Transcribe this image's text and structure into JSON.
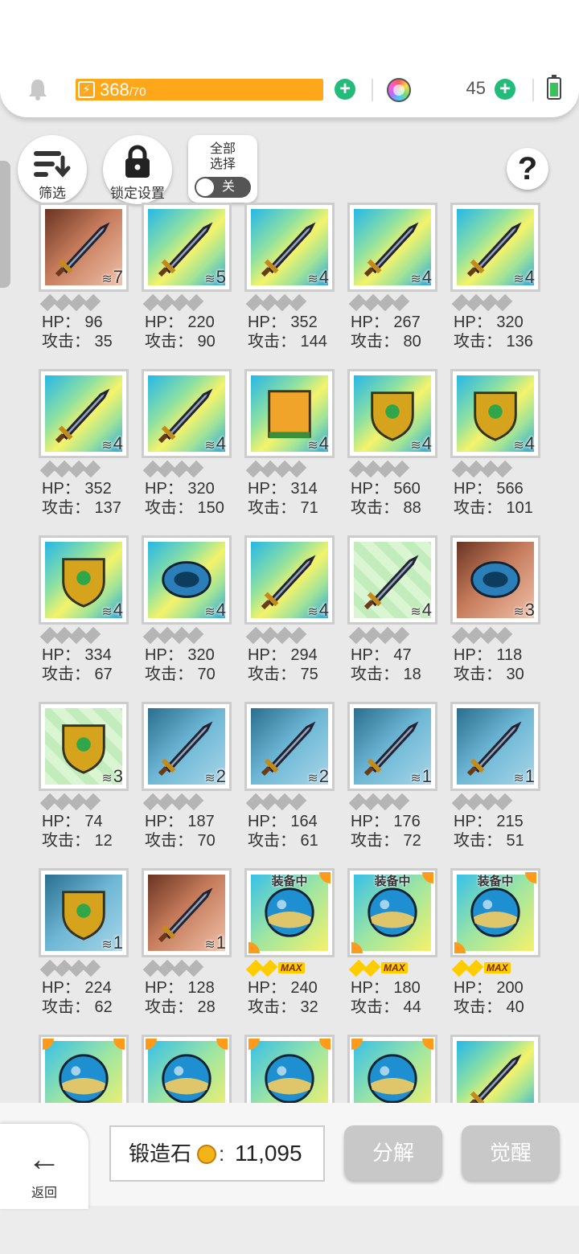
{
  "header": {
    "energy_value": "368",
    "energy_max": "/70",
    "gem_count": "45",
    "colors": {
      "energy": "#ffa71a",
      "plus": "#22bb7a",
      "battery": "#3cc05a"
    }
  },
  "toolbar": {
    "filter_label": "筛选",
    "lock_label": "锁定设置",
    "select_all_label": "全部\n选择",
    "toggle_state": "关",
    "help_label": "?"
  },
  "items": [
    {
      "count": "7",
      "hp": "HP： 96",
      "atk": "攻击： 35",
      "bg": "brown",
      "icon": "sword-icon"
    },
    {
      "count": "5",
      "hp": "HP： 220",
      "atk": "攻击： 90",
      "bg": "rainbow",
      "icon": "golden-spear-icon"
    },
    {
      "count": "4",
      "hp": "HP： 352",
      "atk": "攻击： 144",
      "bg": "rainbow",
      "icon": "blue-sword-icon"
    },
    {
      "count": "4",
      "hp": "HP： 267",
      "atk": "攻击： 80",
      "bg": "rainbow",
      "icon": "crystal-sword-icon"
    },
    {
      "count": "4",
      "hp": "HP： 320",
      "atk": "攻击： 136",
      "bg": "rainbow",
      "icon": "axe-icon"
    },
    {
      "count": "4",
      "hp": "HP： 352",
      "atk": "攻击： 137",
      "bg": "rainbow",
      "icon": "pink-axe-icon"
    },
    {
      "count": "4",
      "hp": "HP： 320",
      "atk": "攻击： 150",
      "bg": "rainbow",
      "icon": "staff-icon"
    },
    {
      "count": "4",
      "hp": "HP： 314",
      "atk": "攻击： 71",
      "bg": "rainbow",
      "icon": "spellbook-icon"
    },
    {
      "count": "4",
      "hp": "HP： 560",
      "atk": "攻击： 88",
      "bg": "rainbow",
      "icon": "winged-shield-icon"
    },
    {
      "count": "4",
      "hp": "HP： 566",
      "atk": "攻击： 101",
      "bg": "rainbow",
      "icon": "dark-shield-icon"
    },
    {
      "count": "4",
      "hp": "HP： 334",
      "atk": "攻击： 67",
      "bg": "rainbow",
      "icon": "emerald-shield-icon"
    },
    {
      "count": "4",
      "hp": "HP： 320",
      "atk": "攻击： 70",
      "bg": "rainbow",
      "icon": "headband-icon"
    },
    {
      "count": "4",
      "hp": "HP： 294",
      "atk": "攻击： 75",
      "bg": "rainbow",
      "icon": "sniper-rifle-icon"
    },
    {
      "count": "4",
      "hp": "HP： 47",
      "atk": "攻击： 18",
      "bg": "green",
      "icon": "dagger-icon"
    },
    {
      "count": "3",
      "hp": "HP： 118",
      "atk": "攻击： 30",
      "bg": "brown",
      "icon": "gauntlet-icon"
    },
    {
      "count": "3",
      "hp": "HP： 74",
      "atk": "攻击： 12",
      "bg": "green",
      "icon": "kite-shield-icon"
    },
    {
      "count": "2",
      "hp": "HP： 187",
      "atk": "攻击： 70",
      "bg": "blue",
      "icon": "blue-blade-icon"
    },
    {
      "count": "2",
      "hp": "HP： 164",
      "atk": "攻击： 61",
      "bg": "blue",
      "icon": "red-spear-icon"
    },
    {
      "count": "1",
      "hp": "HP： 176",
      "atk": "攻击： 72",
      "bg": "blue",
      "icon": "glowing-spear-icon"
    },
    {
      "count": "1",
      "hp": "HP： 215",
      "atk": "攻击： 51",
      "bg": "blue",
      "icon": "scythe-icon"
    },
    {
      "count": "1",
      "hp": "HP： 224",
      "atk": "攻击： 62",
      "bg": "blue",
      "icon": "gear-shield-icon"
    },
    {
      "count": "1",
      "hp": "HP： 128",
      "atk": "攻击： 28",
      "bg": "brown",
      "icon": "crossbow-icon"
    },
    {
      "equipped": "装备中",
      "max": "MAX",
      "hp": "HP： 240",
      "atk": "攻击： 32",
      "bg": "orb",
      "icon": "forest-orb-icon"
    },
    {
      "equipped": "装备中",
      "max": "MAX",
      "hp": "HP： 180",
      "atk": "攻击： 44",
      "bg": "orb",
      "icon": "desert-orb-icon"
    },
    {
      "equipped": "装备中",
      "max": "MAX",
      "hp": "HP： 200",
      "atk": "攻击： 40",
      "bg": "orb",
      "icon": "ocean-orb-icon"
    },
    {
      "bg": "orb",
      "icon": "mountain-orb-icon",
      "partial": true
    },
    {
      "bg": "orb",
      "icon": "crystal-orb-icon",
      "partial": true
    },
    {
      "bg": "orb",
      "icon": "castle-orb-icon",
      "partial": true
    },
    {
      "bg": "orb",
      "icon": "purple-orb-icon",
      "partial": true
    },
    {
      "bg": "rainbow",
      "icon": "dark-sword-icon",
      "partial": true
    }
  ],
  "footer": {
    "back_label": "返回",
    "stone_label": "锻造石",
    "stone_value": "11,095",
    "decompose_label": "分解",
    "awaken_label": "觉醒"
  }
}
